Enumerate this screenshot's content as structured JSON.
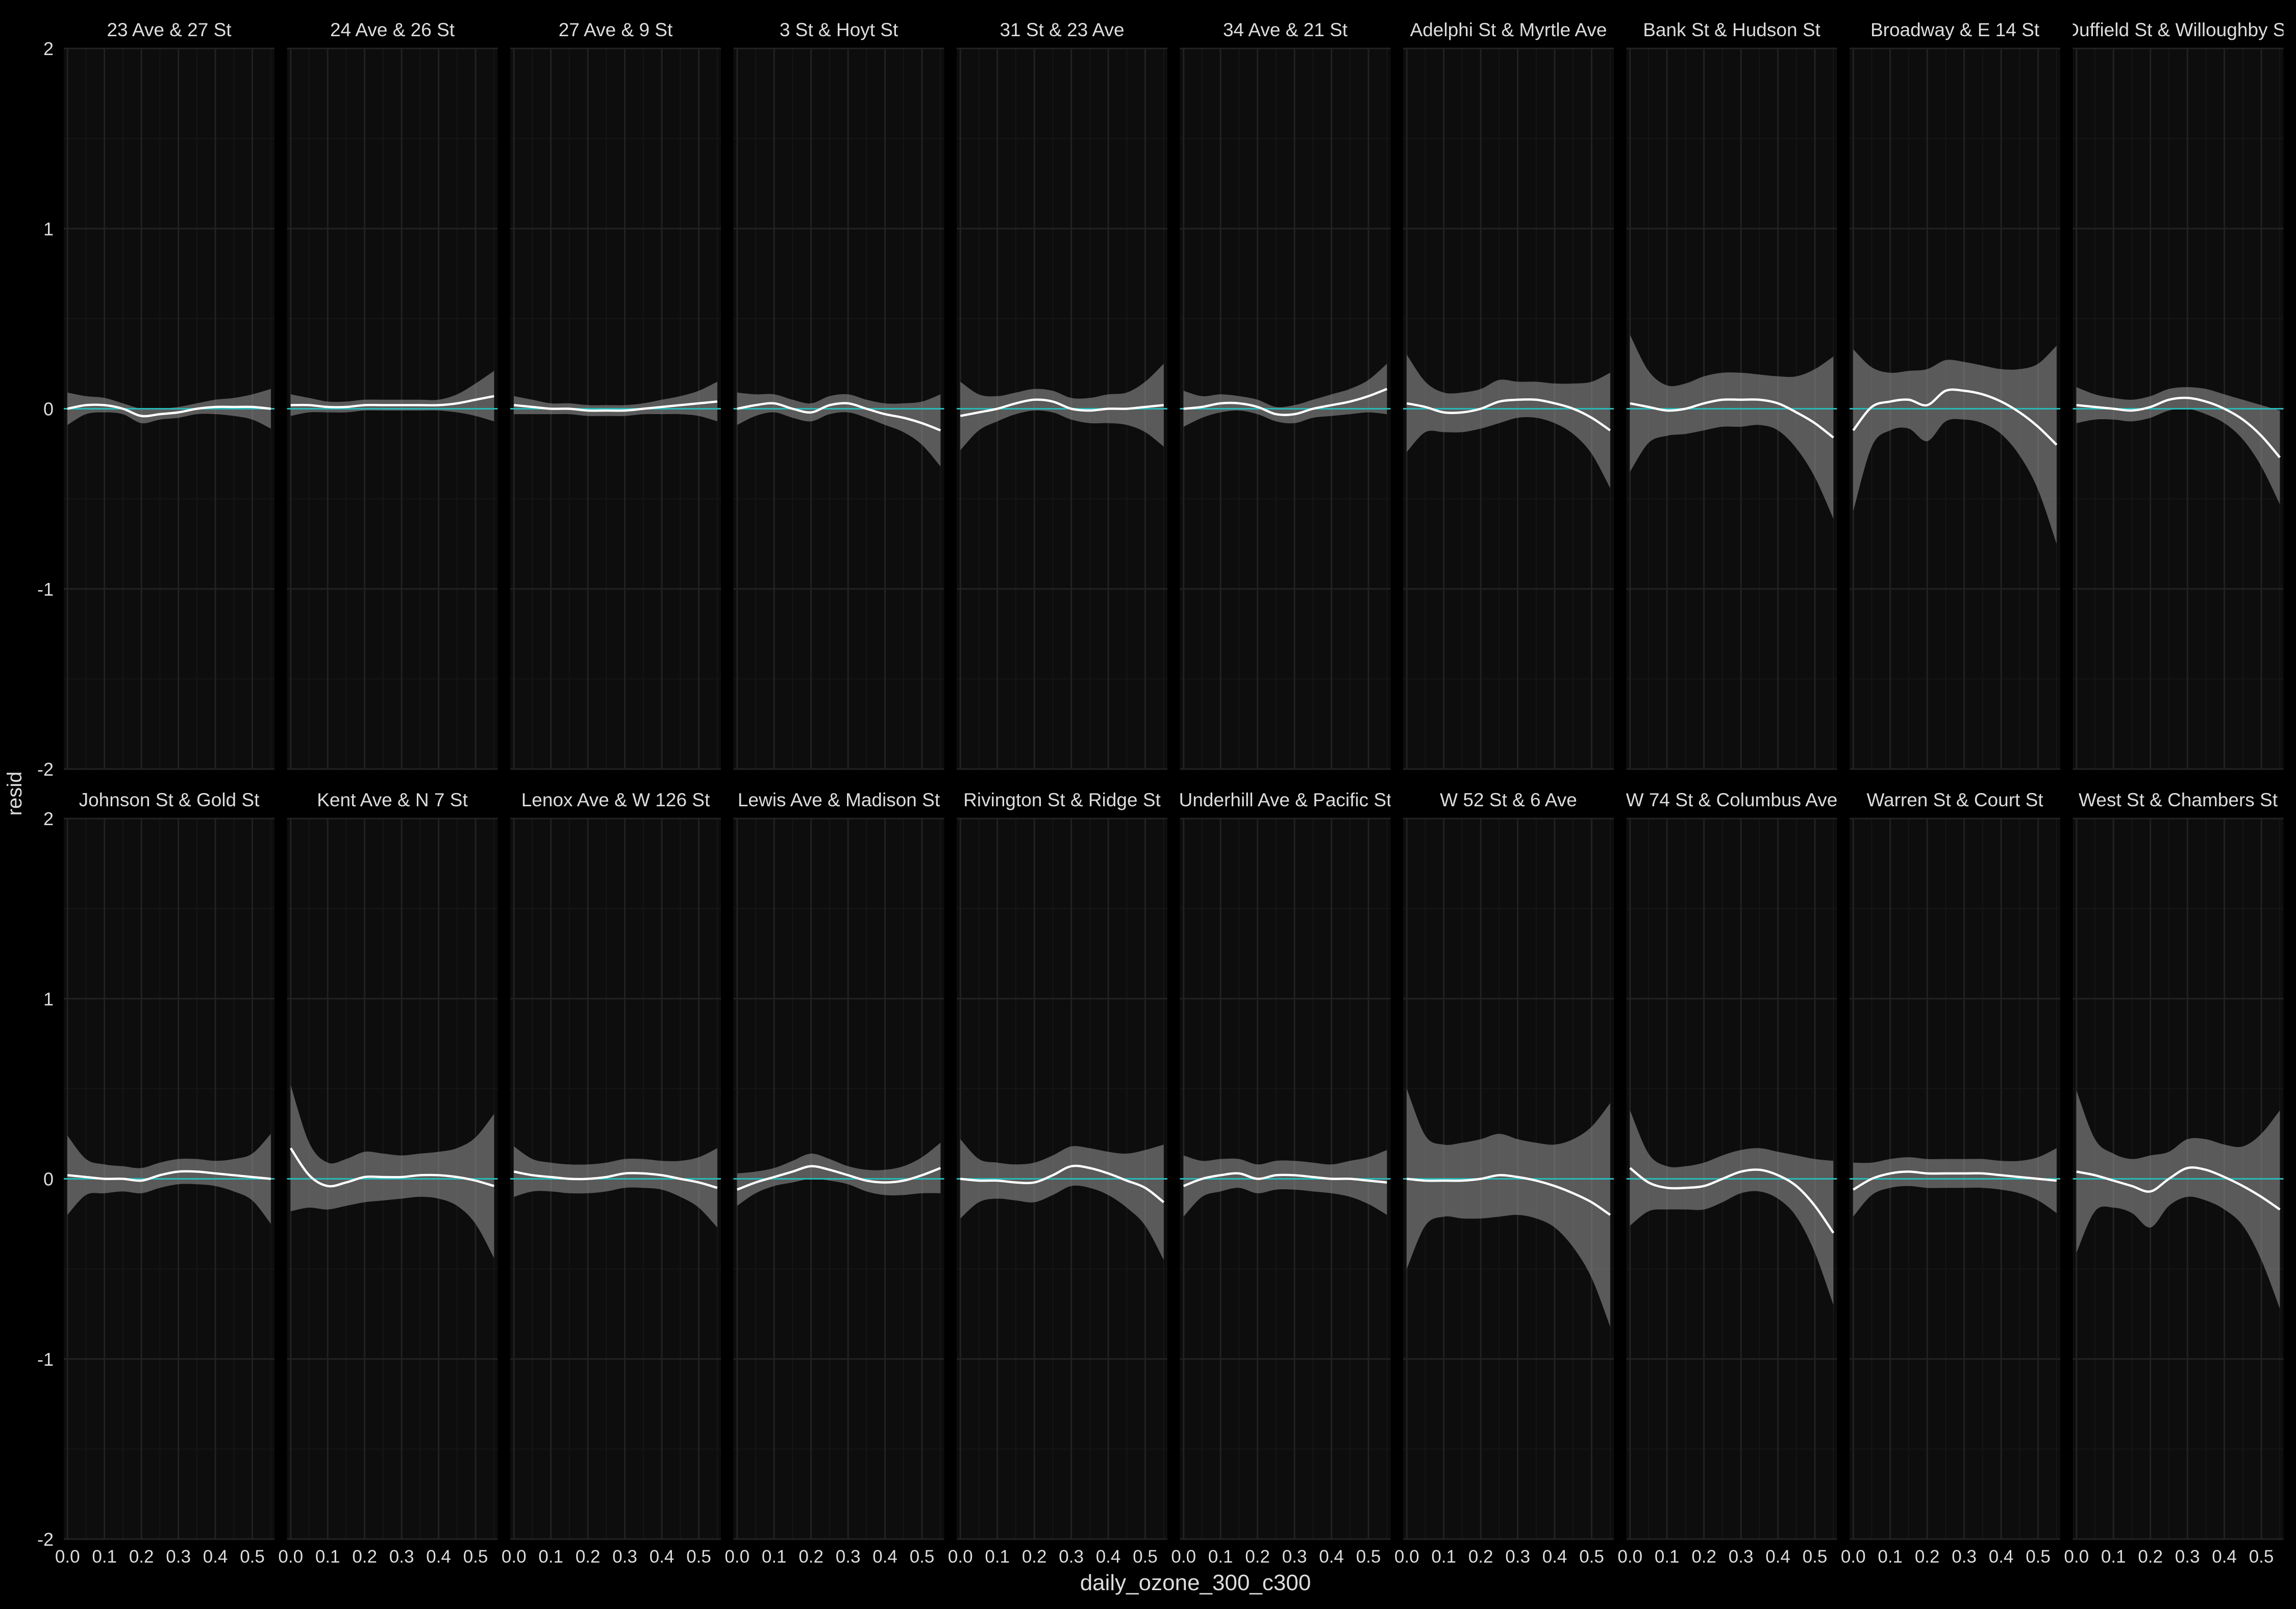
{
  "chart_data": {
    "type": "line",
    "title": "",
    "xlabel": "daily_ozone_300_c300",
    "ylabel": "resid",
    "xlim": [
      -0.01,
      0.56
    ],
    "ylim": [
      -2,
      2
    ],
    "x_ticks": [
      "0.0",
      "0.1",
      "0.2",
      "0.3",
      "0.4",
      "0.5"
    ],
    "x_tick_values": [
      0.0,
      0.1,
      0.2,
      0.3,
      0.4,
      0.5
    ],
    "y_ticks": [
      "-2",
      "-1",
      "0",
      "1",
      "2"
    ],
    "y_tick_values": [
      -2,
      -1,
      0,
      1,
      2
    ],
    "grid": true,
    "layout": {
      "rows": 2,
      "cols": 10
    },
    "x_grid": [
      0,
      0.05,
      0.1,
      0.15,
      0.2,
      0.25,
      0.3,
      0.35,
      0.4,
      0.45,
      0.5,
      0.55
    ],
    "reference_line": {
      "y": 0,
      "color": "#2ab7b7"
    },
    "colors": {
      "background": "#000000",
      "panel": "#0d0d0d",
      "grid_major": "#222222",
      "grid_minor": "#161616",
      "ribbon": "#8a8a8a",
      "smooth_line": "#ffffff",
      "text": "#dddddd"
    },
    "facets": [
      {
        "label": "23 Ave & 27 St",
        "x": [
          0,
          0.05,
          0.1,
          0.15,
          0.2,
          0.25,
          0.3,
          0.35,
          0.4,
          0.45,
          0.5,
          0.55
        ],
        "y": [
          0.0,
          0.02,
          0.02,
          0.0,
          -0.04,
          -0.03,
          -0.02,
          0.0,
          0.01,
          0.01,
          0.01,
          0.0
        ],
        "se": [
          0.09,
          0.05,
          0.04,
          0.03,
          0.04,
          0.03,
          0.03,
          0.03,
          0.04,
          0.05,
          0.07,
          0.11
        ]
      },
      {
        "label": "24 Ave & 26 St",
        "x": [
          0,
          0.05,
          0.1,
          0.15,
          0.2,
          0.25,
          0.3,
          0.35,
          0.4,
          0.45,
          0.5,
          0.55
        ],
        "y": [
          0.02,
          0.02,
          0.01,
          0.01,
          0.02,
          0.02,
          0.02,
          0.02,
          0.02,
          0.03,
          0.05,
          0.07
        ],
        "se": [
          0.06,
          0.04,
          0.03,
          0.03,
          0.03,
          0.03,
          0.03,
          0.03,
          0.03,
          0.05,
          0.09,
          0.14
        ]
      },
      {
        "label": "27 Ave & 9 St",
        "x": [
          0,
          0.05,
          0.1,
          0.15,
          0.2,
          0.25,
          0.3,
          0.35,
          0.4,
          0.45,
          0.5,
          0.55
        ],
        "y": [
          0.02,
          0.01,
          0.0,
          0.0,
          -0.01,
          -0.01,
          -0.01,
          0.0,
          0.01,
          0.02,
          0.03,
          0.04
        ],
        "se": [
          0.05,
          0.04,
          0.03,
          0.03,
          0.03,
          0.03,
          0.03,
          0.03,
          0.04,
          0.05,
          0.07,
          0.11
        ]
      },
      {
        "label": "3 St & Hoyt St",
        "x": [
          0,
          0.05,
          0.1,
          0.15,
          0.2,
          0.25,
          0.3,
          0.35,
          0.4,
          0.45,
          0.5,
          0.55
        ],
        "y": [
          0.0,
          0.02,
          0.03,
          0.0,
          -0.02,
          0.02,
          0.03,
          0.0,
          -0.03,
          -0.05,
          -0.08,
          -0.12
        ],
        "se": [
          0.09,
          0.06,
          0.05,
          0.05,
          0.05,
          0.05,
          0.05,
          0.05,
          0.06,
          0.08,
          0.12,
          0.2
        ]
      },
      {
        "label": "31 St & 23 Ave",
        "x": [
          0,
          0.05,
          0.1,
          0.15,
          0.2,
          0.25,
          0.3,
          0.35,
          0.4,
          0.45,
          0.5,
          0.55
        ],
        "y": [
          -0.04,
          -0.02,
          0.0,
          0.03,
          0.05,
          0.04,
          0.0,
          -0.01,
          0.0,
          0.0,
          0.01,
          0.02
        ],
        "se": [
          0.19,
          0.1,
          0.07,
          0.06,
          0.06,
          0.06,
          0.06,
          0.07,
          0.08,
          0.09,
          0.14,
          0.23
        ]
      },
      {
        "label": "34 Ave & 21 St",
        "x": [
          0,
          0.05,
          0.1,
          0.15,
          0.2,
          0.25,
          0.3,
          0.35,
          0.4,
          0.45,
          0.5,
          0.55
        ],
        "y": [
          0.0,
          0.01,
          0.03,
          0.03,
          0.01,
          -0.03,
          -0.03,
          0.0,
          0.02,
          0.04,
          0.07,
          0.11
        ],
        "se": [
          0.1,
          0.06,
          0.05,
          0.04,
          0.04,
          0.04,
          0.05,
          0.05,
          0.06,
          0.07,
          0.09,
          0.14
        ]
      },
      {
        "label": "Adelphi St & Myrtle Ave",
        "x": [
          0,
          0.05,
          0.1,
          0.15,
          0.2,
          0.25,
          0.3,
          0.35,
          0.4,
          0.45,
          0.5,
          0.55
        ],
        "y": [
          0.03,
          0.01,
          -0.02,
          -0.02,
          0.0,
          0.04,
          0.05,
          0.05,
          0.03,
          0.0,
          -0.05,
          -0.12
        ],
        "se": [
          0.27,
          0.14,
          0.11,
          0.11,
          0.11,
          0.12,
          0.1,
          0.1,
          0.11,
          0.14,
          0.2,
          0.32
        ]
      },
      {
        "label": "Bank St & Hudson St",
        "x": [
          0,
          0.05,
          0.1,
          0.15,
          0.2,
          0.25,
          0.3,
          0.35,
          0.4,
          0.45,
          0.5,
          0.55
        ],
        "y": [
          0.03,
          0.01,
          -0.01,
          0.0,
          0.03,
          0.05,
          0.05,
          0.05,
          0.03,
          -0.02,
          -0.08,
          -0.16
        ],
        "se": [
          0.38,
          0.2,
          0.14,
          0.14,
          0.15,
          0.15,
          0.15,
          0.14,
          0.15,
          0.2,
          0.3,
          0.45
        ]
      },
      {
        "label": "Broadway & E 14 St",
        "x": [
          0,
          0.05,
          0.1,
          0.15,
          0.2,
          0.25,
          0.3,
          0.35,
          0.4,
          0.45,
          0.5,
          0.55
        ],
        "y": [
          -0.12,
          0.01,
          0.04,
          0.05,
          0.02,
          0.1,
          0.1,
          0.08,
          0.04,
          -0.02,
          -0.1,
          -0.2
        ],
        "se": [
          0.45,
          0.22,
          0.16,
          0.16,
          0.2,
          0.17,
          0.16,
          0.16,
          0.18,
          0.24,
          0.35,
          0.55
        ]
      },
      {
        "label": "Duffield St & Willoughby St",
        "x": [
          0,
          0.05,
          0.1,
          0.15,
          0.2,
          0.25,
          0.3,
          0.35,
          0.4,
          0.45,
          0.5,
          0.55
        ],
        "y": [
          0.02,
          0.01,
          0.0,
          -0.01,
          0.01,
          0.05,
          0.06,
          0.04,
          0.0,
          -0.06,
          -0.15,
          -0.27
        ],
        "se": [
          0.1,
          0.07,
          0.06,
          0.06,
          0.06,
          0.06,
          0.06,
          0.07,
          0.08,
          0.11,
          0.17,
          0.26
        ]
      },
      {
        "label": "Johnson St & Gold St",
        "x": [
          0,
          0.05,
          0.1,
          0.15,
          0.2,
          0.25,
          0.3,
          0.35,
          0.4,
          0.45,
          0.5,
          0.55
        ],
        "y": [
          0.02,
          0.01,
          0.0,
          0.0,
          -0.01,
          0.02,
          0.04,
          0.04,
          0.03,
          0.02,
          0.01,
          0.0
        ],
        "se": [
          0.22,
          0.1,
          0.08,
          0.07,
          0.07,
          0.07,
          0.07,
          0.07,
          0.07,
          0.09,
          0.13,
          0.25
        ]
      },
      {
        "label": "Kent Ave & N 7 St",
        "x": [
          0,
          0.05,
          0.1,
          0.15,
          0.2,
          0.25,
          0.3,
          0.35,
          0.4,
          0.45,
          0.5,
          0.55
        ],
        "y": [
          0.17,
          0.02,
          -0.04,
          -0.02,
          0.01,
          0.01,
          0.01,
          0.02,
          0.02,
          0.01,
          -0.01,
          -0.04
        ],
        "se": [
          0.35,
          0.18,
          0.13,
          0.13,
          0.14,
          0.13,
          0.12,
          0.12,
          0.13,
          0.16,
          0.24,
          0.4
        ]
      },
      {
        "label": "Lenox Ave & W 126 St",
        "x": [
          0,
          0.05,
          0.1,
          0.15,
          0.2,
          0.25,
          0.3,
          0.35,
          0.4,
          0.45,
          0.5,
          0.55
        ],
        "y": [
          0.04,
          0.02,
          0.01,
          0.0,
          0.0,
          0.01,
          0.03,
          0.03,
          0.02,
          0.0,
          -0.02,
          -0.05
        ],
        "se": [
          0.14,
          0.09,
          0.08,
          0.08,
          0.08,
          0.08,
          0.08,
          0.08,
          0.08,
          0.1,
          0.14,
          0.22
        ]
      },
      {
        "label": "Lewis Ave & Madison St",
        "x": [
          0,
          0.05,
          0.1,
          0.15,
          0.2,
          0.25,
          0.3,
          0.35,
          0.4,
          0.45,
          0.5,
          0.55
        ],
        "y": [
          -0.06,
          -0.02,
          0.01,
          0.04,
          0.07,
          0.05,
          0.02,
          -0.01,
          -0.02,
          -0.01,
          0.02,
          0.06
        ],
        "se": [
          0.09,
          0.06,
          0.05,
          0.06,
          0.07,
          0.06,
          0.05,
          0.06,
          0.07,
          0.08,
          0.1,
          0.14
        ]
      },
      {
        "label": "Rivington St & Ridge St",
        "x": [
          0,
          0.05,
          0.1,
          0.15,
          0.2,
          0.25,
          0.3,
          0.35,
          0.4,
          0.45,
          0.5,
          0.55
        ],
        "y": [
          0.0,
          -0.01,
          -0.01,
          -0.02,
          -0.02,
          0.02,
          0.07,
          0.06,
          0.03,
          -0.01,
          -0.05,
          -0.13
        ],
        "se": [
          0.22,
          0.12,
          0.1,
          0.1,
          0.11,
          0.11,
          0.11,
          0.11,
          0.12,
          0.15,
          0.21,
          0.32
        ]
      },
      {
        "label": "Underhill Ave & Pacific St",
        "x": [
          0,
          0.05,
          0.1,
          0.15,
          0.2,
          0.25,
          0.3,
          0.35,
          0.4,
          0.45,
          0.5,
          0.55
        ],
        "y": [
          -0.04,
          0.0,
          0.02,
          0.03,
          0.0,
          0.02,
          0.02,
          0.01,
          0.0,
          0.0,
          -0.01,
          -0.02
        ],
        "se": [
          0.17,
          0.1,
          0.09,
          0.08,
          0.08,
          0.08,
          0.08,
          0.08,
          0.08,
          0.1,
          0.13,
          0.18
        ]
      },
      {
        "label": "W 52 St & 6 Ave",
        "x": [
          0,
          0.05,
          0.1,
          0.15,
          0.2,
          0.25,
          0.3,
          0.35,
          0.4,
          0.45,
          0.5,
          0.55
        ],
        "y": [
          0.0,
          -0.01,
          -0.01,
          -0.01,
          0.0,
          0.02,
          0.01,
          -0.01,
          -0.04,
          -0.08,
          -0.13,
          -0.2
        ],
        "se": [
          0.5,
          0.25,
          0.2,
          0.21,
          0.22,
          0.23,
          0.21,
          0.21,
          0.23,
          0.3,
          0.42,
          0.62
        ]
      },
      {
        "label": "W 74 St & Columbus Ave",
        "x": [
          0,
          0.05,
          0.1,
          0.15,
          0.2,
          0.25,
          0.3,
          0.35,
          0.4,
          0.45,
          0.5,
          0.55
        ],
        "y": [
          0.06,
          -0.02,
          -0.05,
          -0.05,
          -0.04,
          0.0,
          0.04,
          0.05,
          0.02,
          -0.04,
          -0.15,
          -0.3
        ],
        "se": [
          0.32,
          0.16,
          0.12,
          0.12,
          0.13,
          0.13,
          0.12,
          0.12,
          0.13,
          0.17,
          0.26,
          0.4
        ]
      },
      {
        "label": "Warren St & Court St",
        "x": [
          0,
          0.05,
          0.1,
          0.15,
          0.2,
          0.25,
          0.3,
          0.35,
          0.4,
          0.45,
          0.5,
          0.55
        ],
        "y": [
          -0.06,
          0.0,
          0.03,
          0.04,
          0.03,
          0.03,
          0.03,
          0.03,
          0.02,
          0.01,
          0.0,
          -0.01
        ],
        "se": [
          0.15,
          0.09,
          0.08,
          0.08,
          0.08,
          0.08,
          0.08,
          0.08,
          0.08,
          0.09,
          0.12,
          0.18
        ]
      },
      {
        "label": "West St & Chambers St",
        "x": [
          0,
          0.05,
          0.1,
          0.15,
          0.2,
          0.25,
          0.3,
          0.35,
          0.4,
          0.45,
          0.5,
          0.55
        ],
        "y": [
          0.04,
          0.02,
          -0.01,
          -0.04,
          -0.07,
          0.0,
          0.06,
          0.05,
          0.01,
          -0.04,
          -0.1,
          -0.17
        ],
        "se": [
          0.45,
          0.2,
          0.15,
          0.15,
          0.2,
          0.15,
          0.16,
          0.17,
          0.18,
          0.22,
          0.35,
          0.55
        ]
      }
    ]
  }
}
